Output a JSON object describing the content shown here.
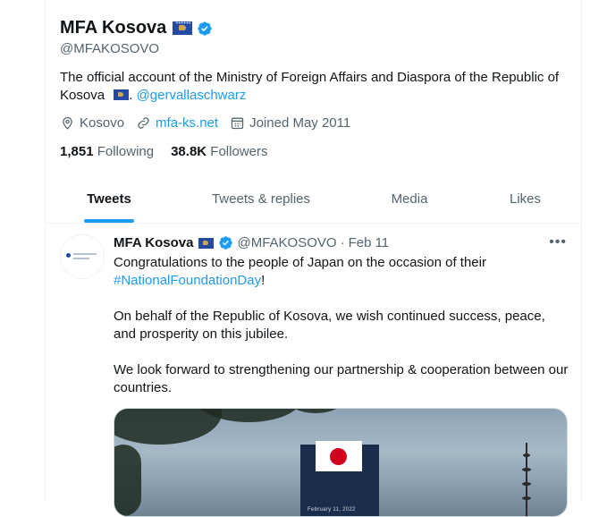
{
  "profile": {
    "name": "MFA Kosova",
    "handle": "@MFAKOSOVO",
    "bio_text": "The official account of the Ministry of Foreign Affairs and Diaspora of the Republic of Kosova",
    "bio_suffix": ".",
    "bio_mention": "@gervallaschwarz",
    "location": "Kosovo",
    "website": "mfa-ks.net",
    "joined": "Joined May 2011",
    "following_count": "1,851",
    "following_label": "Following",
    "followers_count": "38.8K",
    "followers_label": "Followers"
  },
  "tabs": [
    {
      "label": "Tweets",
      "active": true
    },
    {
      "label": "Tweets & replies",
      "active": false
    },
    {
      "label": "Media",
      "active": false
    },
    {
      "label": "Likes",
      "active": false
    }
  ],
  "tweet": {
    "name": "MFA Kosova",
    "handle": "@MFAKOSOVO",
    "separator": "·",
    "date": "Feb 11",
    "line1": "Congratulations to the people of Japan on the occasion of their",
    "hashtag": "#NationalFoundationDay",
    "hashtag_suffix": "!",
    "para2": "On behalf of the Republic of Kosova, we wish continued success, peace, and prosperity on this jubilee.",
    "para3": "We look forward to strengthening our partnership & cooperation between our countries.",
    "media_caption": "February 11, 2022",
    "more_label": "•••"
  },
  "colors": {
    "accent": "#1d9bf0",
    "text": "#0f1419",
    "secondary": "#536471",
    "border": "#eff3f4",
    "kosovo_blue": "#244aa5",
    "kosovo_gold": "#d0a650"
  },
  "icons": [
    "kosovo-flag-icon",
    "verified-badge-icon",
    "location-pin-icon",
    "link-icon",
    "calendar-icon",
    "more-options-icon"
  ]
}
